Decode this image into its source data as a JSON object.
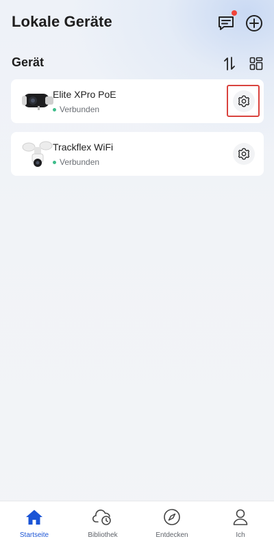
{
  "header": {
    "title": "Lokale Geräte",
    "messages_icon": "chat-icon",
    "add_icon": "add-circle-icon",
    "notification_color": "#f0443a"
  },
  "section": {
    "title": "Gerät",
    "sort_icon": "sort-icon",
    "layout_icon": "grid-layout-icon"
  },
  "devices": [
    {
      "name": "Elite XPro PoE",
      "status": "Verbunden",
      "status_color": "#3ebc8a",
      "settings_icon": "gear-icon"
    },
    {
      "name": "Trackflex WiFi",
      "status": "Verbunden",
      "status_color": "#3ebc8a",
      "settings_icon": "gear-icon"
    }
  ],
  "tabbar": {
    "tabs": [
      {
        "label": "Startseite",
        "icon": "home-icon",
        "active": true
      },
      {
        "label": "Bibliothek",
        "icon": "cloud-clock-icon",
        "active": false
      },
      {
        "label": "Entdecken",
        "icon": "compass-icon",
        "active": false
      },
      {
        "label": "Ich",
        "icon": "person-icon",
        "active": false
      }
    ],
    "active_color": "#1a54d6"
  }
}
